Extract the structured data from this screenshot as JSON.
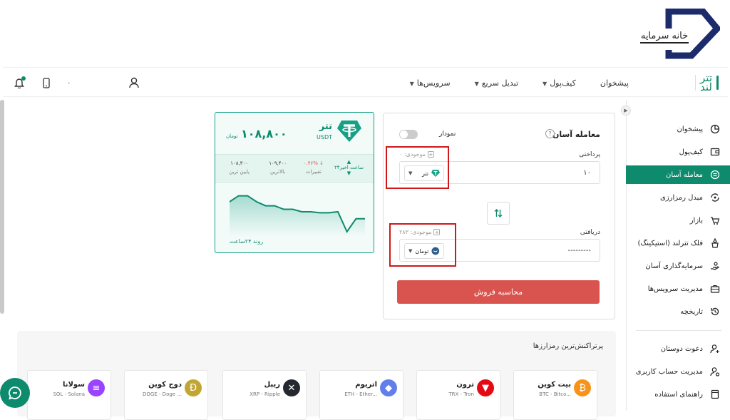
{
  "header": {
    "logo_text": "خانه سرمایه",
    "brand_name_line1": "تتر",
    "brand_name_line2": "لند",
    "nav": [
      {
        "label": "پیشخوان",
        "has_dropdown": false
      },
      {
        "label": "کیف‌پول",
        "has_dropdown": true
      },
      {
        "label": "تبدیل سریع",
        "has_dropdown": true
      },
      {
        "label": "سرویس‌ها",
        "has_dropdown": true
      }
    ],
    "count_badge": "۰",
    "icons": [
      "bell-icon",
      "mobile-icon",
      "user-icon"
    ]
  },
  "sidebar": {
    "items": [
      {
        "label": "پیشخوان",
        "icon": "chart-pie-icon",
        "active": false
      },
      {
        "label": "کیف‌پول",
        "icon": "wallet-icon",
        "active": false
      },
      {
        "label": "معامله آسان",
        "icon": "exchange-icon",
        "active": true
      },
      {
        "label": "مبدل رمزارزی",
        "icon": "converter-icon",
        "active": false
      },
      {
        "label": "بازار",
        "icon": "market-icon",
        "active": false
      },
      {
        "label": "فلک تترلند (استیکینگ)",
        "icon": "staking-icon",
        "active": false
      },
      {
        "label": "سرمایه‌گذاری آسان",
        "icon": "invest-icon",
        "active": false
      },
      {
        "label": "مدیریت سرویس‌ها",
        "icon": "briefcase-icon",
        "active": false
      },
      {
        "label": "تاریخچه",
        "icon": "history-icon",
        "active": false
      }
    ],
    "bottom_items": [
      {
        "label": "دعوت دوستان",
        "icon": "user-add-icon"
      },
      {
        "label": "مدیریت حساب کاربری",
        "icon": "user-settings-icon"
      },
      {
        "label": "راهنمای استفاده",
        "icon": "book-icon"
      }
    ]
  },
  "trade": {
    "title": "معامله آسان",
    "chart_toggle_label": "نمودار",
    "pay_label": "پرداختی",
    "pay_balance": "موجودی: ۰",
    "pay_value": "۱۰",
    "pay_coin": "تتر",
    "receive_label": "دریافتی",
    "receive_balance": "موجودی: ۲۸۳",
    "receive_value": "---------",
    "receive_coin": "تومان",
    "submit_label": "محاسبه فروش"
  },
  "price_card": {
    "coin_name": "تتر",
    "coin_symbol": "USDT",
    "price": "۱۰۸,۸۰۰",
    "price_unit": "تومان",
    "period_label": "۲۴ساعت اخیر",
    "change_value": "۰.۴۶%",
    "change_label": "تغییرات",
    "high_value": "۱۰۹,۴۰۰",
    "high_label": "بالاترین",
    "low_value": "۱۰۸,۳۰۰",
    "low_label": "پایین ترین",
    "trend_label": "روند ۲۴ساعت",
    "trend_values": [
      0.7,
      0.82,
      0.82,
      0.7,
      0.62,
      0.62,
      0.55,
      0.55,
      0.5,
      0.5,
      0.48,
      0.48,
      0.5,
      0.1,
      0.36,
      0.36
    ],
    "colors": {
      "accent": "#0e8a6c",
      "down": "#d9534f"
    }
  },
  "popular": {
    "title": "پرتراکنش‌ترین رمزارزها",
    "coins": [
      {
        "name": "بیت کوین",
        "sub": "BTC - Bitco...",
        "color": "#f7931a",
        "glyph": "₿"
      },
      {
        "name": "ترون",
        "sub": "TRX - Tron",
        "color": "#e50914",
        "glyph": "▼"
      },
      {
        "name": "اتریوم",
        "sub": "ETH - Ether...",
        "color": "#627eea",
        "glyph": "◆"
      },
      {
        "name": "ریپل",
        "sub": "XRP - Ripple",
        "color": "#23292f",
        "glyph": "✕"
      },
      {
        "name": "دوج کوین",
        "sub": "DOGE - Doge ...",
        "color": "#c2a633",
        "glyph": "Ð"
      },
      {
        "name": "سولانا",
        "sub": "SOL - Solana",
        "color": "#9945ff",
        "glyph": "≡"
      }
    ]
  }
}
